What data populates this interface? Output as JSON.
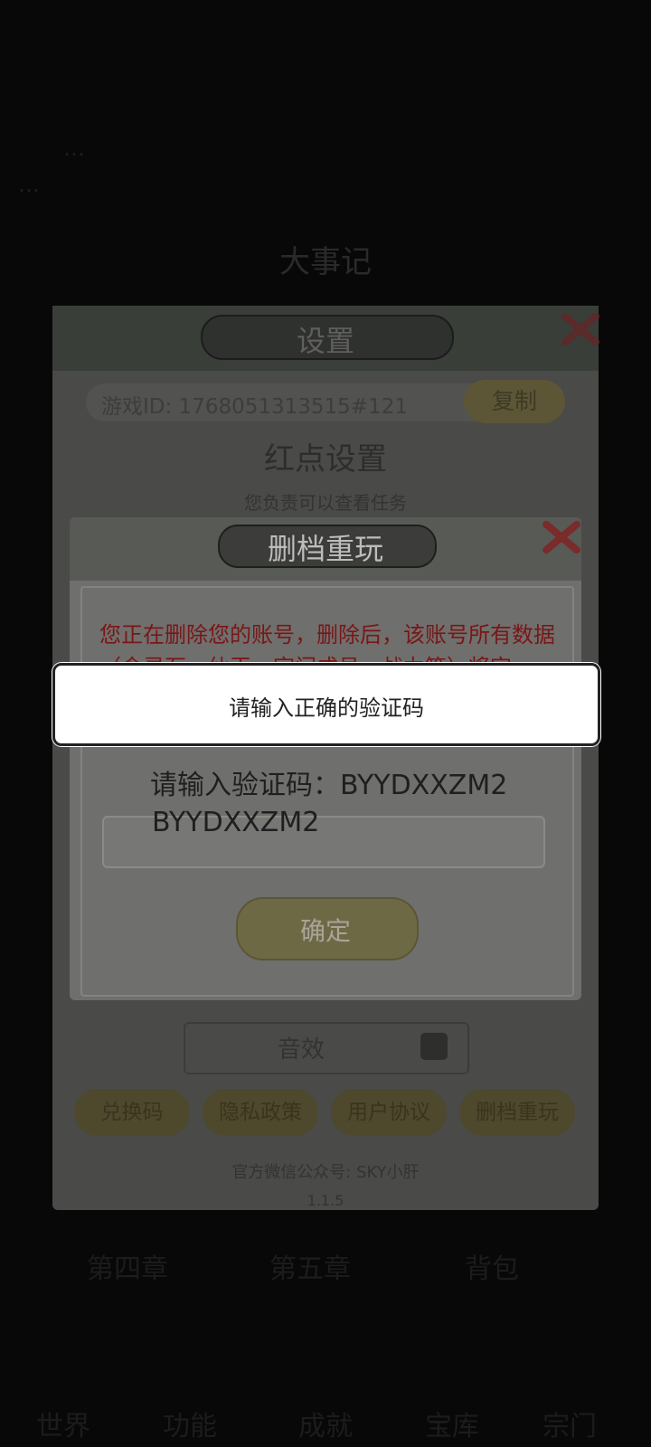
{
  "background": {
    "line1": "…",
    "line2": "…",
    "heading": "大事记",
    "bottom_row": [
      "第四章",
      "第五章",
      "背包"
    ],
    "bottom_nav": [
      "世界",
      "功能",
      "成就",
      "宝库",
      "宗门"
    ]
  },
  "settings": {
    "title": "设置",
    "game_id": "游戏ID: 1768051313515#121",
    "copy_label": "复制",
    "red_dot_title": "红点设置",
    "row_text": "您负责可以查看任务",
    "sfx_label": "音效",
    "buttons": [
      "兑换码",
      "隐私政策",
      "用户协议",
      "删档重玩"
    ],
    "wechat": "官方微信公众号: SKY小肝",
    "version": "1.1.5"
  },
  "dialog": {
    "title": "删档重玩",
    "warning": "您正在删除您的账号，删除后，该账号所有数据（含灵石、仙玉、宗门成员、战力等）将完",
    "prompt": "请输入验证码：BYYDXXZM2",
    "input_value": "BYYDXXZM2",
    "confirm_label": "确定"
  },
  "toast": {
    "message": "请输入正确的验证码"
  },
  "colors": {
    "toast_bg": "#ffffff",
    "warning_red": "#b0201e",
    "close_red": "#c0392b"
  }
}
